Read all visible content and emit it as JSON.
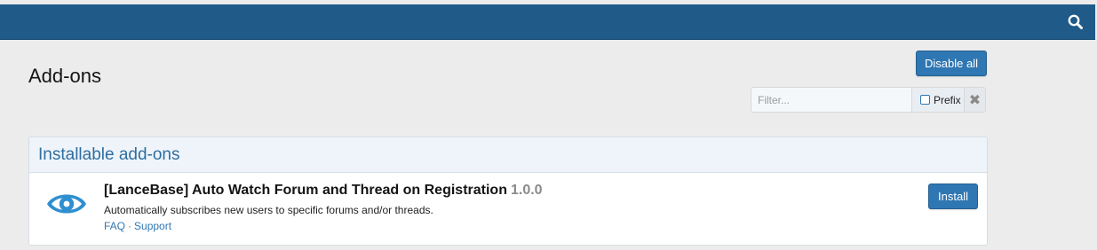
{
  "header": {
    "search_icon": "search-icon",
    "bar_color": "#1f5a88"
  },
  "page": {
    "title": "Add-ons",
    "disable_all_label": "Disable all"
  },
  "filter": {
    "placeholder": "Filter...",
    "prefix_label": "Prefix",
    "clear_glyph": "✖"
  },
  "installable": {
    "heading": "Installable add-ons",
    "addons": [
      {
        "icon": "eye-icon",
        "title": "[LanceBase] Auto Watch Forum and Thread on Registration",
        "version": "1.0.0",
        "description": "Automatically subscribes new users to specific forums and/or threads.",
        "faq_label": "FAQ",
        "separator": "·",
        "support_label": "Support",
        "install_label": "Install"
      }
    ]
  },
  "colors": {
    "accent": "#2f77b3",
    "link": "#2f77b3",
    "heading": "#2f6ea0"
  }
}
